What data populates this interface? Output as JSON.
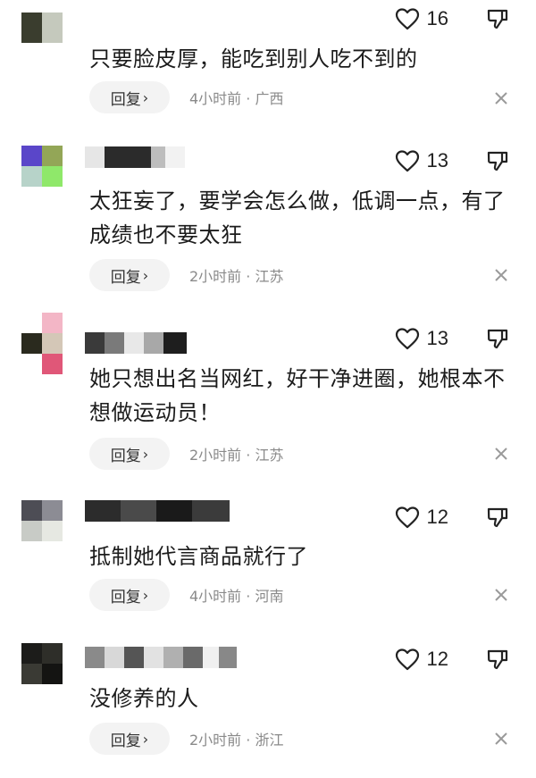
{
  "comments": [
    {
      "likes": "16",
      "text": "只要脸皮厚，能吃到别人吃不到的",
      "reply_label": "回复",
      "meta": "4小时前 · 广西",
      "avatar_colors": [
        "#3a3d2e",
        "#c5c9bd",
        "#ffffff",
        "#ffffff"
      ],
      "name_blocks": []
    },
    {
      "likes": "13",
      "text": "太狂妄了，要学会怎么做，低调一点，有了成绩也不要太狂",
      "reply_label": "回复",
      "meta": "2小时前 · 江苏",
      "avatar_colors": [
        "#5a46c9",
        "#93a657",
        "#b7d3c9",
        "#8fe86a"
      ],
      "name_blocks": [
        "#e6e6e6",
        "#2b2b2b",
        "#bdbdbd",
        "#f2f2f2"
      ]
    },
    {
      "likes": "13",
      "text": "她只想出名当网红，好干净进圈，她根本不想做运动员！",
      "reply_label": "回复",
      "meta": "2小时前 · 江苏",
      "avatar_colors": [
        "#f3b6c6",
        "#2a2a1e",
        "#d4c7b7",
        "#e05778"
      ],
      "name_blocks": [
        "#3a3a3a",
        "#7a7a7a",
        "#e8e8e8",
        "#a8a8a8",
        "#1e1e1e"
      ]
    },
    {
      "likes": "12",
      "text": "抵制她代言商品就行了",
      "reply_label": "回复",
      "meta": "4小时前 · 河南",
      "avatar_colors": [
        "#4d4d55",
        "#8c8c94",
        "#c8cbc6",
        "#e6e8e2"
      ],
      "name_blocks": [
        "#2c2c2c",
        "#4a4a4a",
        "#1a1a1a",
        "#3b3b3b"
      ]
    },
    {
      "likes": "12",
      "text": "没修养的人",
      "reply_label": "回复",
      "meta": "2小时前 · 浙江",
      "avatar_colors": [
        "#1c1c1a",
        "#2e2e29",
        "#3a3a34",
        "#141412"
      ],
      "name_blocks": [
        "#8a8a8a",
        "#d8d8d8",
        "#555555",
        "#e2e2e2",
        "#b0b0b0",
        "#6a6a6a",
        "#f0f0f0",
        "#888888"
      ]
    }
  ]
}
